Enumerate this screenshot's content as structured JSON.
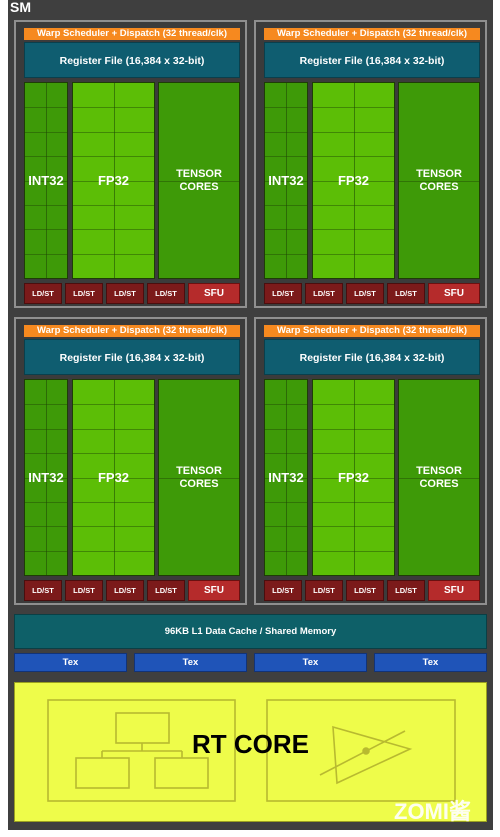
{
  "sm": {
    "label": "SM",
    "partitions": [
      {
        "warp_scheduler": "Warp Scheduler + Dispatch (32 thread/clk)",
        "register_file": "Register File (16,384 x 32-bit)",
        "int32": "INT32",
        "fp32": "FP32",
        "tensor_line1": "TENSOR",
        "tensor_line2": "CORES",
        "ldst": [
          "LD/ST",
          "LD/ST",
          "LD/ST",
          "LD/ST"
        ],
        "sfu": "SFU"
      },
      {
        "warp_scheduler": "Warp Scheduler + Dispatch (32 thread/clk)",
        "register_file": "Register File (16,384 x 32-bit)",
        "int32": "INT32",
        "fp32": "FP32",
        "tensor_line1": "TENSOR",
        "tensor_line2": "CORES",
        "ldst": [
          "LD/ST",
          "LD/ST",
          "LD/ST",
          "LD/ST"
        ],
        "sfu": "SFU"
      },
      {
        "warp_scheduler": "Warp Scheduler + Dispatch (32 thread/clk)",
        "register_file": "Register File (16,384 x 32-bit)",
        "int32": "INT32",
        "fp32": "FP32",
        "tensor_line1": "TENSOR",
        "tensor_line2": "CORES",
        "ldst": [
          "LD/ST",
          "LD/ST",
          "LD/ST",
          "LD/ST"
        ],
        "sfu": "SFU"
      },
      {
        "warp_scheduler": "Warp Scheduler + Dispatch (32 thread/clk)",
        "register_file": "Register File (16,384 x 32-bit)",
        "int32": "INT32",
        "fp32": "FP32",
        "tensor_line1": "TENSOR",
        "tensor_line2": "CORES",
        "ldst": [
          "LD/ST",
          "LD/ST",
          "LD/ST",
          "LD/ST"
        ],
        "sfu": "SFU"
      }
    ],
    "l1_cache": "96KB L1 Data Cache / Shared Memory",
    "tex_units": [
      "Tex",
      "Tex",
      "Tex",
      "Tex"
    ],
    "rt_core": "RT CORE",
    "rt_icons": [
      "bvh-tree-icon",
      "ray-triangle-intersection-icon"
    ]
  },
  "watermark": "ZOMI酱",
  "colors": {
    "warp_scheduler": "#f6891f",
    "register_file": "#0f5d70",
    "int32": "#3e9a08",
    "fp32": "#5cbe06",
    "tensor": "#3e9a08",
    "ldst": "#7b1a1a",
    "sfu": "#b52b2b",
    "l1_cache": "#0e6068",
    "tex": "#1f54b8",
    "rt_core": "#eefc4a"
  }
}
